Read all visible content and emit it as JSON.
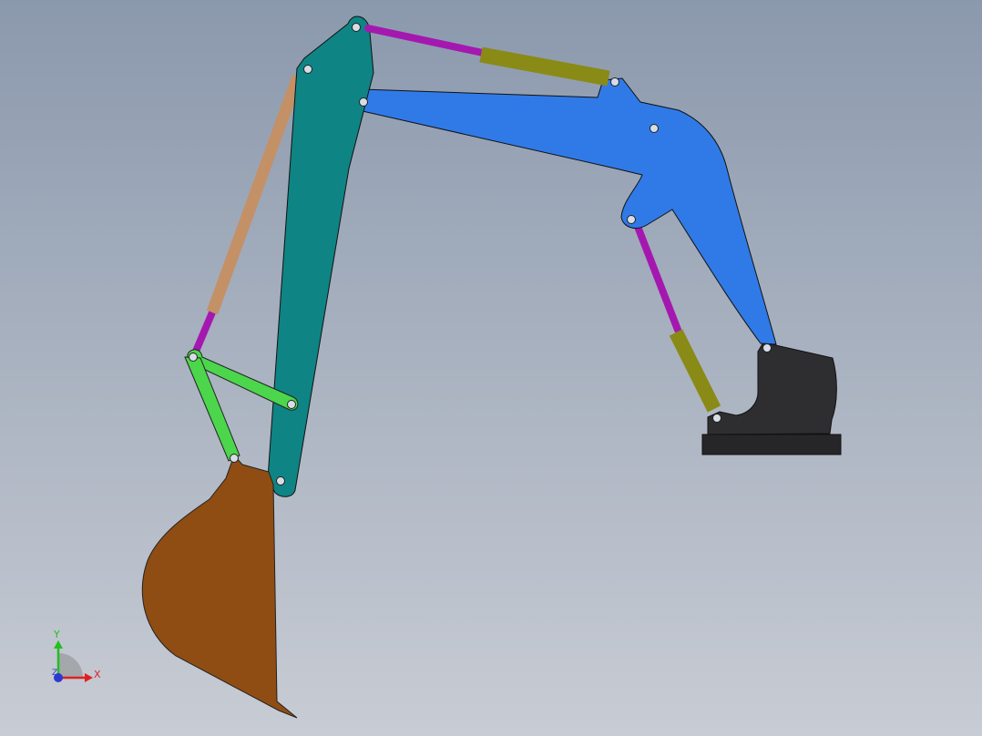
{
  "viewport": {
    "background_top": "#8b99ad",
    "background_bottom": "#c8ccd4"
  },
  "colors": {
    "boom": "#307ae8",
    "arm": "#0f8484",
    "bucket": "#8f4d14",
    "linkage": "#4cd64c",
    "base_mount": "#2e2e30",
    "base_plate": "#262628",
    "cylinder_barrel_olive": "#8a8a16",
    "cylinder_barrel_tan": "#c49066",
    "cylinder_rod": "#a418b0",
    "pin": "#d6dde6",
    "outline": "#1e1e1e"
  },
  "triad": {
    "x_label": "X",
    "y_label": "Y",
    "z_label": "Z",
    "x_color": "#e02020",
    "y_color": "#20c020",
    "z_color": "#2a3ad0"
  }
}
